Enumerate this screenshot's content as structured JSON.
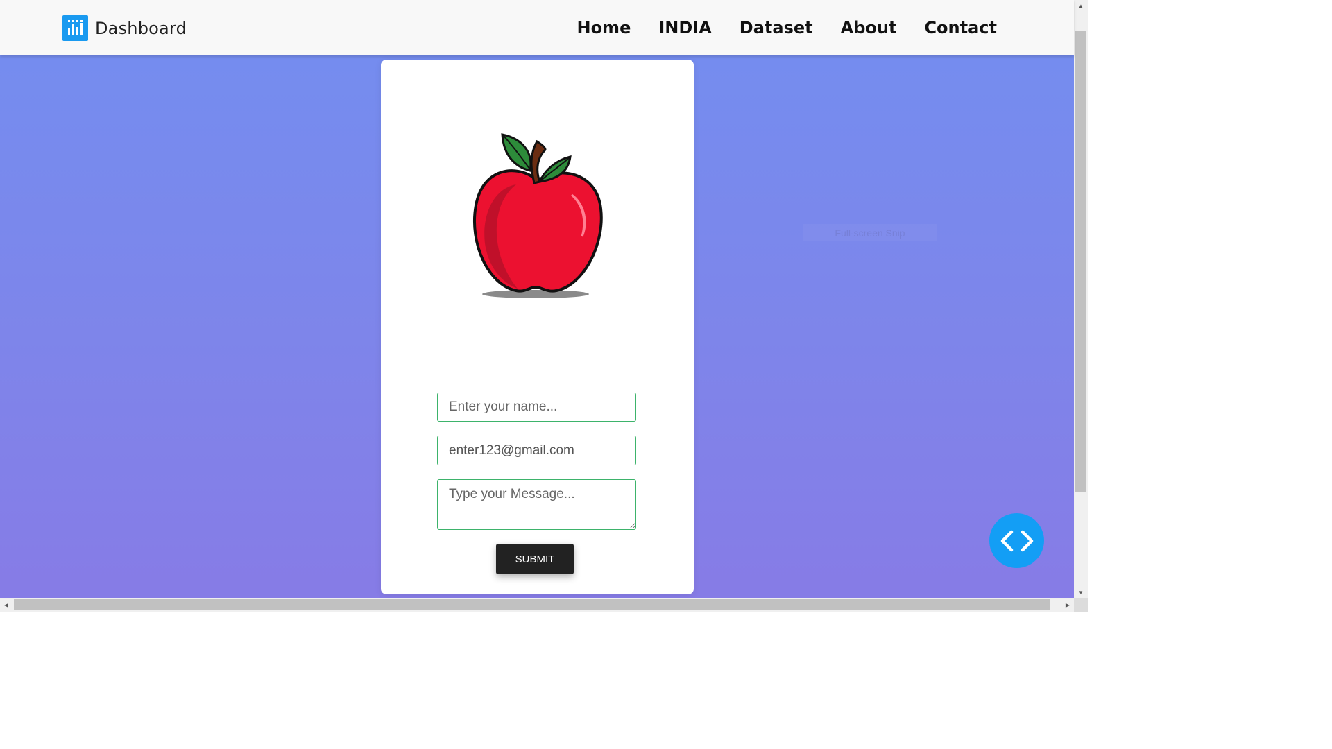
{
  "navbar": {
    "brand": "Dashboard",
    "brand_icon": "bar-chart-icon",
    "brand_color": "#1a9af0",
    "links": [
      "Home",
      "INDIA",
      "Dataset",
      "About",
      "Contact"
    ]
  },
  "form": {
    "image": "apple-illustration",
    "name_placeholder": "Enter your name...",
    "email_value": "enter123@gmail.com",
    "message_placeholder": "Type your Message...",
    "submit_label": "SUBMIT",
    "field_border_color": "#3db36b"
  },
  "overlay": {
    "snip_label": "Full-screen Snip"
  },
  "floating_button": {
    "icon": "code-icon",
    "color": "#139ef5"
  },
  "background": {
    "gradient_top": "#738ef0",
    "gradient_bottom": "#877be6"
  }
}
